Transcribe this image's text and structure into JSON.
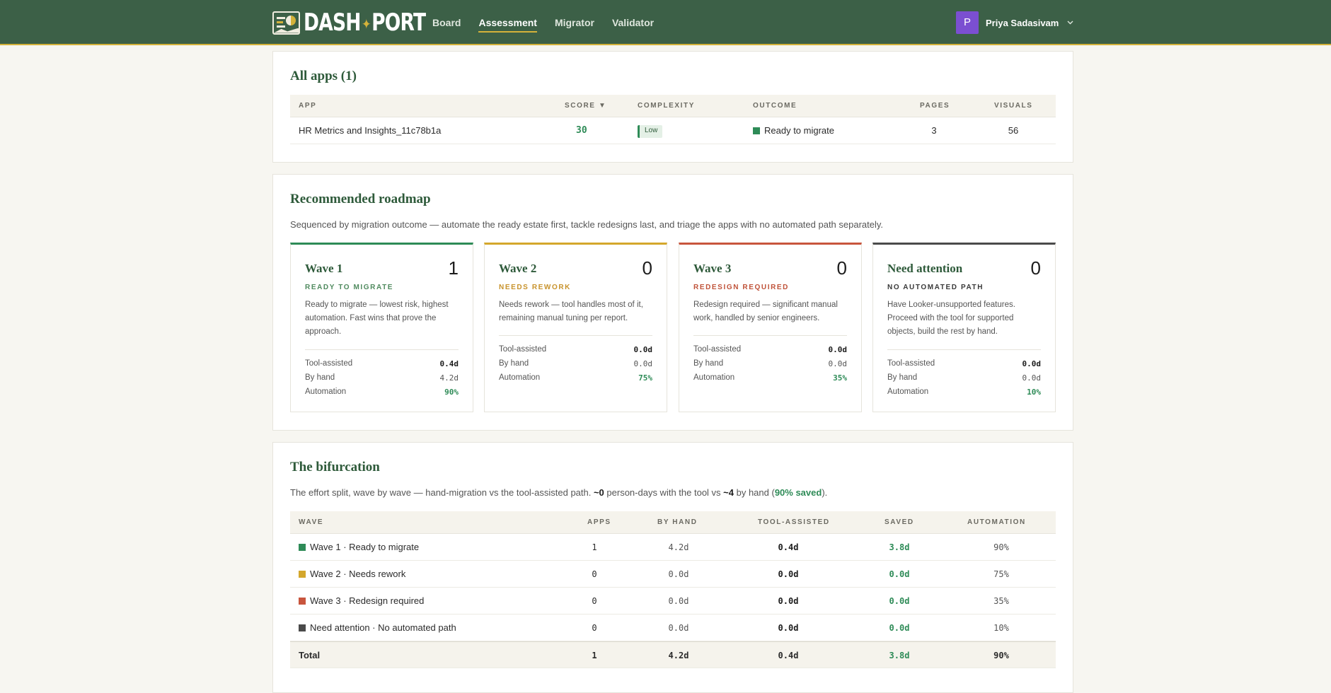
{
  "header": {
    "brand": {
      "left": "DASH",
      "spark": "✦",
      "right": "PORT"
    },
    "nav": [
      {
        "label": "Board",
        "active": false
      },
      {
        "label": "Assessment",
        "active": true
      },
      {
        "label": "Migrator",
        "active": false
      },
      {
        "label": "Validator",
        "active": false
      }
    ],
    "user": {
      "initial": "P",
      "name": "Priya Sadasivam",
      "menu_icon": "chevron-down-icon"
    }
  },
  "all_apps": {
    "title": "All apps (1)",
    "columns": {
      "app": "APP",
      "score": "SCORE ▼",
      "complexity": "COMPLEXITY",
      "outcome": "OUTCOME",
      "pages": "PAGES",
      "visuals": "VISUALS"
    },
    "rows": [
      {
        "app": "HR Metrics and Insights_11c78b1a",
        "score": "30",
        "complexity": "Low",
        "outcome": "Ready to migrate",
        "outcome_color": "#2e8b57",
        "pages": "3",
        "visuals": "56"
      }
    ]
  },
  "roadmap": {
    "title": "Recommended roadmap",
    "subtitle": "Sequenced by migration outcome — automate the ready estate first, tackle redesigns last, and triage the apps with no automated path separately.",
    "waves": [
      {
        "title": "Wave 1",
        "count": "1",
        "sub": "READY TO MIGRATE",
        "color": "#2e8b57",
        "desc": "Ready to migrate — lowest risk, highest automation. Fast wins that prove the approach.",
        "tool_label": "Tool-assisted",
        "tool": "0.4d",
        "hand_label": "By hand",
        "hand": "4.2d",
        "auto_label": "Automation",
        "auto": "90%"
      },
      {
        "title": "Wave 2",
        "count": "0",
        "sub": "NEEDS REWORK",
        "color": "#d4a72c",
        "desc": "Needs rework — tool handles most of it, remaining manual tuning per report.",
        "tool_label": "Tool-assisted",
        "tool": "0.0d",
        "hand_label": "By hand",
        "hand": "0.0d",
        "auto_label": "Automation",
        "auto": "75%"
      },
      {
        "title": "Wave 3",
        "count": "0",
        "sub": "REDESIGN REQUIRED",
        "color": "#c8553d",
        "desc": "Redesign required — significant manual work, handled by senior engineers.",
        "tool_label": "Tool-assisted",
        "tool": "0.0d",
        "hand_label": "By hand",
        "hand": "0.0d",
        "auto_label": "Automation",
        "auto": "35%"
      },
      {
        "title": "Need attention",
        "count": "0",
        "sub": "NO AUTOMATED PATH",
        "color": "#4a4a4a",
        "desc": "Have Looker-unsupported features. Proceed with the tool for supported objects, build the rest by hand.",
        "tool_label": "Tool-assisted",
        "tool": "0.0d",
        "hand_label": "By hand",
        "hand": "0.0d",
        "auto_label": "Automation",
        "auto": "10%"
      }
    ]
  },
  "bifurcation": {
    "title": "The bifurcation",
    "subtitle": {
      "part1": "The effort split, wave by wave — hand-migration vs the tool-assisted path. ",
      "tool_days": "~0",
      "part2": " person-days with the tool vs ",
      "hand_days": "~4",
      "part3": " by hand (",
      "saved_pct": "90% saved",
      "part4": ")."
    },
    "columns": {
      "wave": "WAVE",
      "apps": "APPS",
      "by_hand": "BY HAND",
      "tool": "TOOL-ASSISTED",
      "saved": "SAVED",
      "automation": "AUTOMATION"
    },
    "rows": [
      {
        "wave": "Wave 1 · Ready to migrate",
        "color": "#2e8b57",
        "apps": "1",
        "by_hand": "4.2d",
        "tool": "0.4d",
        "saved": "3.8d",
        "automation": "90%"
      },
      {
        "wave": "Wave 2 · Needs rework",
        "color": "#d4a72c",
        "apps": "0",
        "by_hand": "0.0d",
        "tool": "0.0d",
        "saved": "0.0d",
        "automation": "75%"
      },
      {
        "wave": "Wave 3 · Redesign required",
        "color": "#c8553d",
        "apps": "0",
        "by_hand": "0.0d",
        "tool": "0.0d",
        "saved": "0.0d",
        "automation": "35%"
      },
      {
        "wave": "Need attention · No automated path",
        "color": "#4a4a4a",
        "apps": "0",
        "by_hand": "0.0d",
        "tool": "0.0d",
        "saved": "0.0d",
        "automation": "10%"
      }
    ],
    "total": {
      "wave": "Total",
      "apps": "1",
      "by_hand": "4.2d",
      "tool": "0.4d",
      "saved": "3.8d",
      "automation": "90%"
    }
  }
}
